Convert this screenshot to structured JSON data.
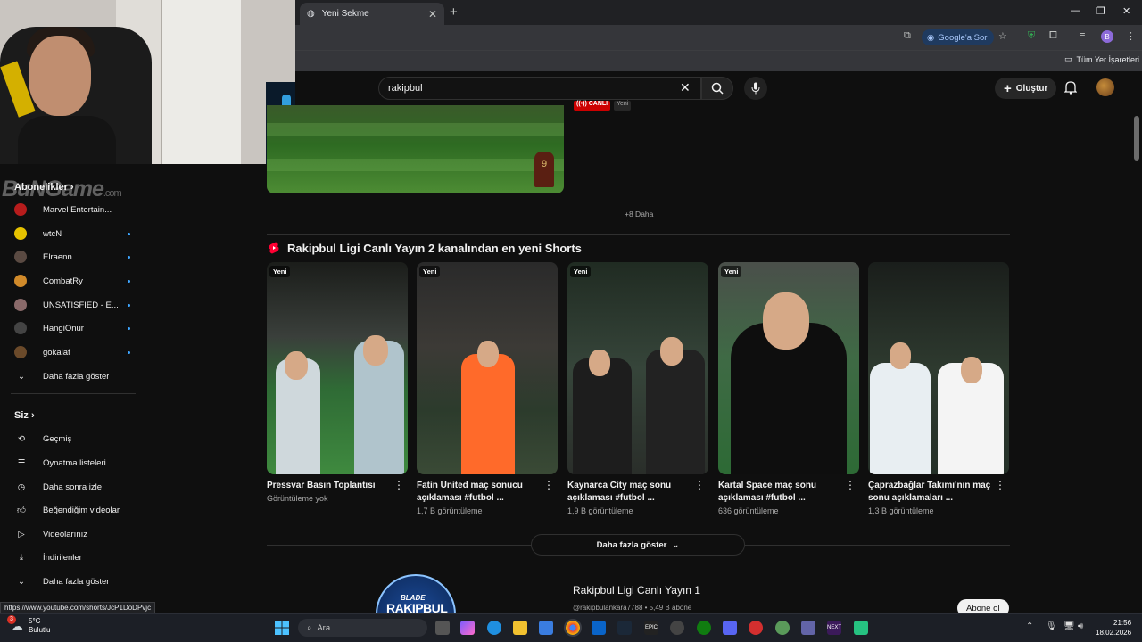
{
  "browser": {
    "tab_title": "Yeni Sekme",
    "google_sor_label": "Google'a Sor",
    "profile_initial": "B",
    "bookmarks_label": "Tüm Yer İşaretleri"
  },
  "youtube": {
    "search_value": "rakipbul",
    "create_label": "Oluştur"
  },
  "sidebar": {
    "subscriptions_header": "Abonelikler",
    "subscriptions": [
      {
        "label": "Marvel Entertain...",
        "color": "#b71c1c"
      },
      {
        "label": "wtcN",
        "color": "#e6c200"
      },
      {
        "label": "Elraenn",
        "color": "#5a4a42"
      },
      {
        "label": "CombatRy",
        "color": "#d08a2a"
      },
      {
        "label": "UNSATISFIED - E...",
        "color": "#8a6a6a"
      },
      {
        "label": "HangiOnur",
        "color": "#444"
      },
      {
        "label": "gokalaf",
        "color": "#6b4a2a"
      }
    ],
    "show_more_subs": "Daha fazla göster",
    "you_header": "Siz",
    "you_items": [
      {
        "label": "Geçmiş",
        "icon": "history-icon"
      },
      {
        "label": "Oynatma listeleri",
        "icon": "playlist-icon"
      },
      {
        "label": "Daha sonra izle",
        "icon": "clock-icon"
      },
      {
        "label": "Beğendiğim videolar",
        "icon": "thumbs-up-icon"
      },
      {
        "label": "Videolarınız",
        "icon": "play-icon"
      },
      {
        "label": "İndirilenler",
        "icon": "download-icon"
      }
    ],
    "show_more_you": "Daha fazla göster"
  },
  "watermark": {
    "text": "BuNGame",
    "suffix": ".com"
  },
  "top_video": {
    "live_badge": "CANLI",
    "new_badge": "Yeni",
    "more_count": "+8 Daha"
  },
  "shorts": {
    "section_title": "Rakipbul Ligi Canlı Yayın 2 kanalından en yeni Shorts",
    "items": [
      {
        "badge": "Yeni",
        "title": "Pressvar Basın Toplantısı",
        "views": "Görüntüleme yok"
      },
      {
        "badge": "Yeni",
        "title": "Fatin United maç sonucu açıklaması #futbol ...",
        "views": "1,7 B görüntüleme"
      },
      {
        "badge": "Yeni",
        "title": "Kaynarca City maç sonu açıklaması #futbol ...",
        "views": "1,9 B görüntüleme"
      },
      {
        "badge": "Yeni",
        "title": "Kartal Space maç sonu açıklaması #futbol ...",
        "views": "636 görüntüleme"
      },
      {
        "badge": "",
        "title": "Çaprazbağlar Takımı'nın maç sonu açıklamaları ...",
        "views": "1,3 B görüntüleme"
      }
    ],
    "show_more": "Daha fazla göster"
  },
  "channel": {
    "avatar_text_small": "BLADE",
    "avatar_text_big": "RAKIPBUL",
    "name": "Rakipbul Ligi Canlı Yayın 1",
    "meta": "@rakipbulankara7788 • 5,49 B abone",
    "subscribe_label": "Abone ol"
  },
  "status_url": "https://www.youtube.com/shorts/JcP1DoDPvjc",
  "taskbar": {
    "temp": "5°C",
    "weather": "Bulutlu",
    "weather_badge": "3",
    "search_placeholder": "Ara",
    "time": "21:56",
    "date": "18.02.2026"
  }
}
